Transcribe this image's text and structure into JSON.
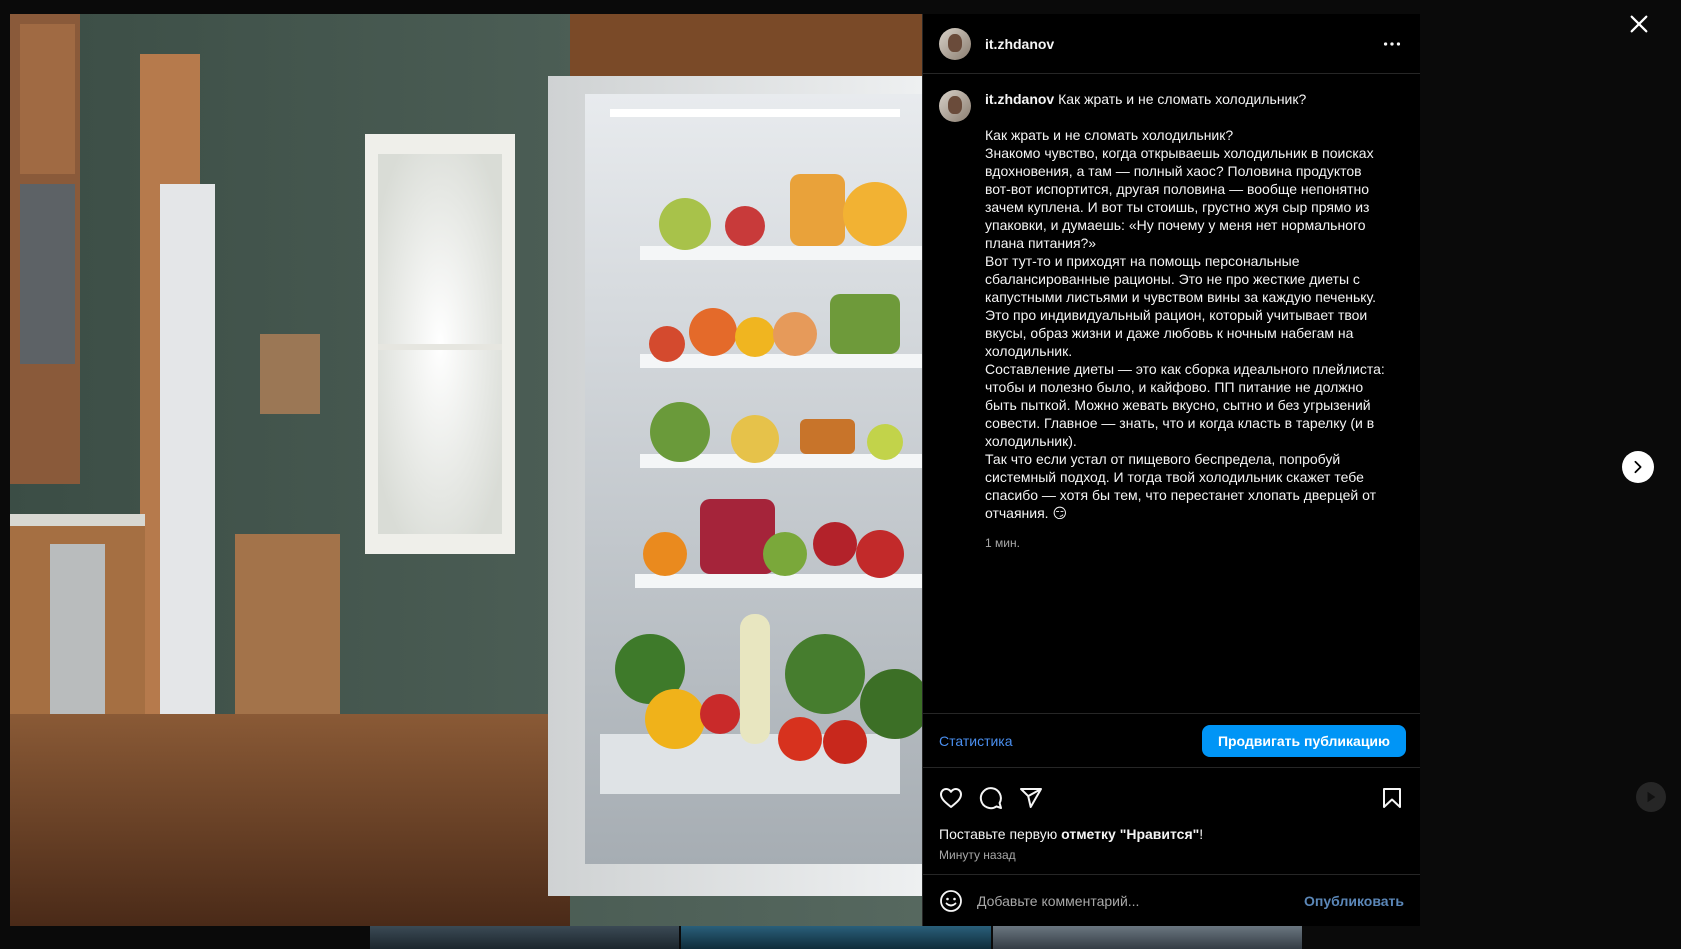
{
  "post": {
    "username": "it.zhdanov",
    "caption_title": "Как жрать и не сломать холодильник?",
    "caption_text": "Как жрать и не сломать холодильник?\nЗнакомо чувство, когда открываешь холодильник в поисках вдохновения, а там — полный хаос? Половина продуктов вот-вот испортится, другая половина — вообще непонятно зачем куплена. И вот ты стоишь, грустно жуя сыр прямо из упаковки, и думаешь: «Ну почему у меня нет нормального плана питания?»\nВот тут-то и приходят на помощь персональные сбалансированные рационы. Это не про жесткие диеты с капустными листьями и чувством вины за каждую печеньку. Это про индивидуальный рацион, который учитывает твои вкусы, образ жизни и даже любовь к ночным набегам на холодильник.\nСоставление диеты — это как сборка идеального плейлиста: чтобы и полезно было, и кайфово. ПП питание не должно быть пыткой. Можно жевать вкусно, сытно и без угрызений совести. Главное — знать, что и когда класть в тарелку (и в холодильник).\nТак что если устал от пищевого беспредела, попробуй системный подход. И тогда твой холодильник скажет тебе спасибо — хотя бы тем, что перестанет хлопать дверцей от отчаяния. 😏",
    "caption_time": "1 мин.",
    "stats_label": "Статистика",
    "promote_label": "Продвигать публикацию",
    "likes_prefix": "Поставьте первую ",
    "likes_bold": "отметку \"Нравится\"",
    "likes_suffix": "!",
    "posted_ago": "Минуту назад",
    "comment_placeholder": "Добавьте комментарий...",
    "publish_label": "Опубликовать"
  },
  "icons": {
    "close": "close-icon",
    "next": "chevron-right-icon",
    "more": "more-horizontal-icon",
    "like": "heart-icon",
    "comment": "comment-icon",
    "share": "send-icon",
    "save": "bookmark-icon",
    "emoji": "emoji-icon"
  },
  "colors": {
    "accent": "#0095f6",
    "link": "#4a8ff0",
    "muted": "#a8a8a8",
    "background": "#000000"
  }
}
